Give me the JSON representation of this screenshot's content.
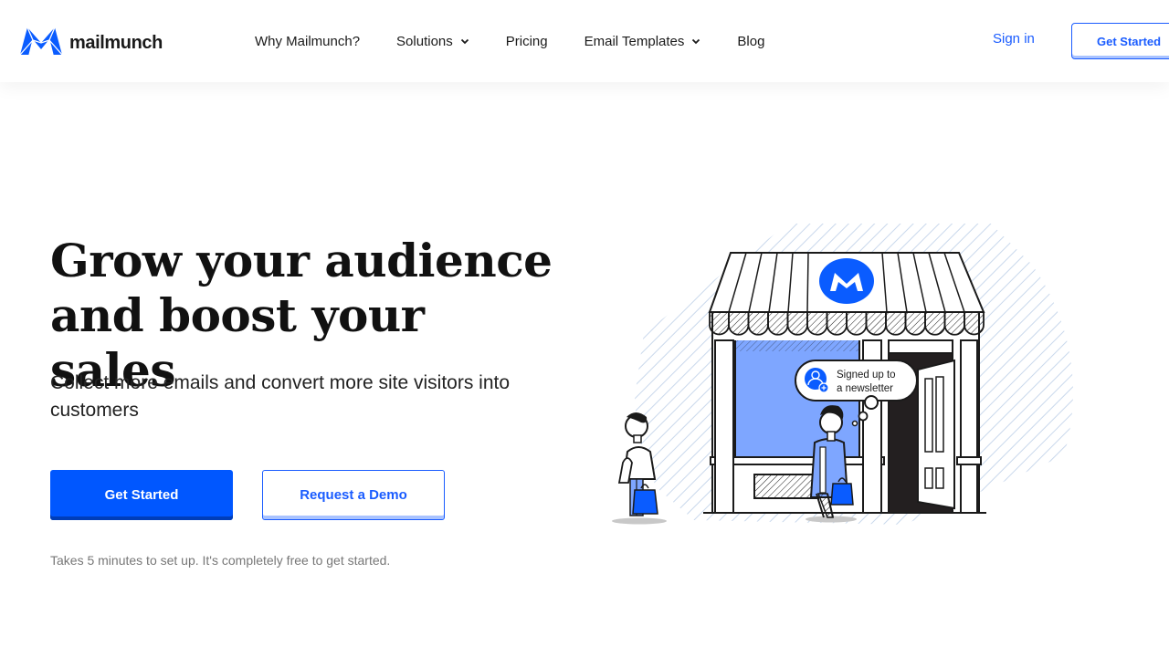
{
  "brand": {
    "name": "mailmunch",
    "accent": "#0057ff",
    "link_color": "#1a5cff"
  },
  "nav": {
    "items": [
      {
        "label": "Why Mailmunch?",
        "has_dropdown": false
      },
      {
        "label": "Solutions",
        "has_dropdown": true
      },
      {
        "label": "Pricing",
        "has_dropdown": false
      },
      {
        "label": "Email Templates",
        "has_dropdown": true
      },
      {
        "label": "Blog",
        "has_dropdown": false
      }
    ],
    "sign_in": "Sign in",
    "cta": "Get Started"
  },
  "hero": {
    "title_line1": "Grow your audience",
    "title_line2": "and boost your sales",
    "subtitle": "Collect more emails and convert more site visitors into customers",
    "primary_cta": "Get Started",
    "secondary_cta": "Request a Demo",
    "note": "Takes 5 minutes to set up. It's completely free to get started."
  },
  "illustration": {
    "bubble_line1": "Signed up to",
    "bubble_line2": "a newsletter",
    "icons": [
      "mailmunch-logo-icon",
      "user-plus-icon",
      "shopping-bag-icon"
    ]
  }
}
